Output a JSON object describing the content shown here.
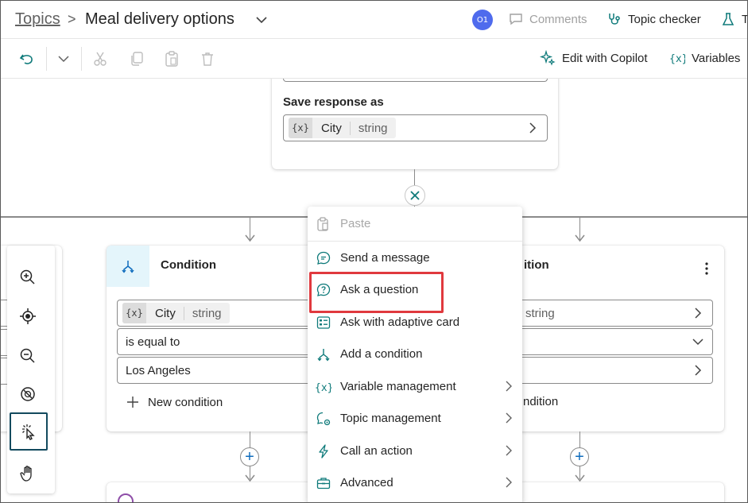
{
  "header": {
    "breadcrumb_root": "Topics",
    "breadcrumb_sep": ">",
    "title": "Meal delivery options",
    "avatar_initials": "O1",
    "comments_label": "Comments",
    "topic_checker_label": "Topic checker",
    "test_label": "T"
  },
  "toolbar": {
    "edit_copilot_label": "Edit with Copilot",
    "variables_label": "Variables"
  },
  "question_node": {
    "save_label": "Save response as",
    "var_symbol": "{x}",
    "var_name": "City",
    "var_type": "string"
  },
  "condition_left": {
    "title": "Condition",
    "var_symbol": "{x}",
    "var_name": "City",
    "var_type": "string",
    "operator": "is equal to",
    "value": "Los Angeles",
    "new_condition_label": "New condition"
  },
  "condition_right": {
    "title_partial": "ition",
    "var_type": "string",
    "new_condition_partial": "ndition"
  },
  "menu": {
    "items": [
      {
        "label": "Paste",
        "icon": "paste-icon",
        "disabled": true
      },
      {
        "label": "Send a message",
        "icon": "message-icon"
      },
      {
        "label": "Ask a question",
        "icon": "question-icon"
      },
      {
        "label": "Ask with adaptive card",
        "icon": "adaptive-card-icon"
      },
      {
        "label": "Add a condition",
        "icon": "condition-icon"
      },
      {
        "label": "Variable management",
        "icon": "variable-icon",
        "submenu": true
      },
      {
        "label": "Topic management",
        "icon": "topic-icon",
        "submenu": true
      },
      {
        "label": "Call an action",
        "icon": "lightning-icon",
        "submenu": true
      },
      {
        "label": "Advanced",
        "icon": "toolbox-icon",
        "submenu": true
      }
    ]
  },
  "colors": {
    "accent": "#0f6cbd",
    "teal": "#0e7a7a",
    "highlight": "#e0393e",
    "avatar": "#4f6bed"
  }
}
